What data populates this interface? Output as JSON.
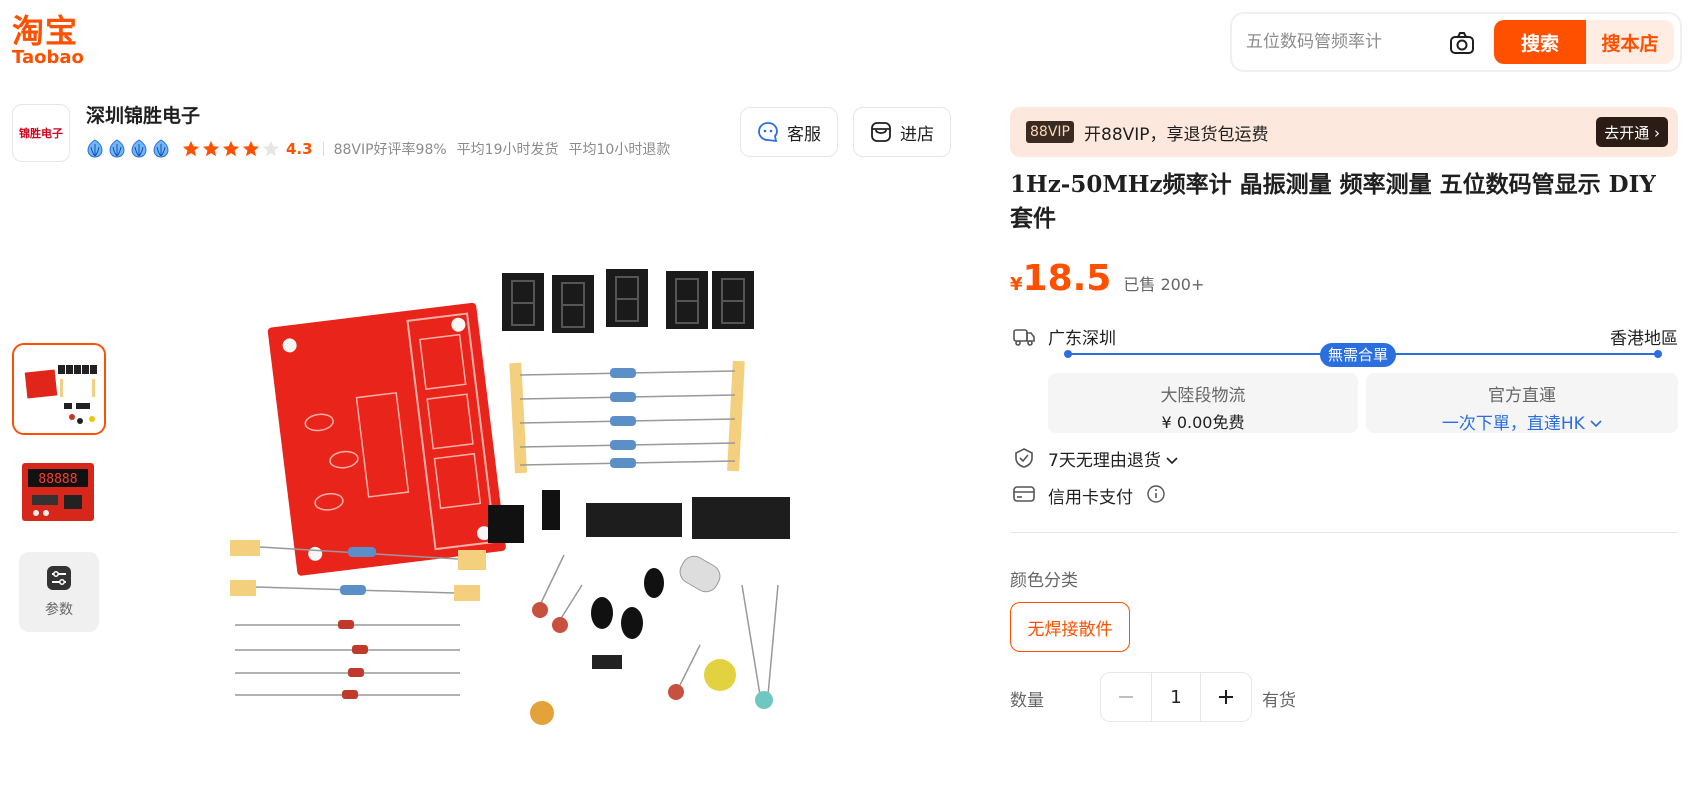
{
  "header": {
    "logo_cn": "淘宝",
    "logo_en": "Taobao",
    "search_placeholder": "五位数码管频率计",
    "search_button": "搜索",
    "store_search_button": "搜本店",
    "accent": "#ff5000"
  },
  "shop": {
    "logo_text": "锦胜电子",
    "name": "深圳锦胜电子",
    "crown_count": 4,
    "rating": "4.3",
    "star_rating": 4.3,
    "stats": [
      "88VIP好评率98%",
      "平均19小时发货",
      "平均10小时退款"
    ],
    "service_button": "客服",
    "enter_button": "进店"
  },
  "gallery": {
    "params_label": "参数"
  },
  "vip": {
    "badge": "88VIP",
    "text": "开88VIP，享退货包运费",
    "cta": "去开通"
  },
  "product": {
    "title": "1Hz-50MHz频率计 晶振测量 频率测量 五位数码管显示 DIY套件",
    "currency": "¥",
    "price": "18.5",
    "sold": "已售 200+"
  },
  "shipping": {
    "origin": "广东深圳",
    "destination": "香港地區",
    "route_tag": "無需合單",
    "card1_title": "大陸段物流",
    "card1_value": "¥ 0.00免费",
    "card2_title": "官方直運",
    "card2_value": "一次下單，直達HK",
    "route_color": "#2a6ee0"
  },
  "services": {
    "return_policy": "7天无理由退货",
    "payment": "信用卡支付"
  },
  "sku": {
    "color_label": "颜色分类",
    "option": "无焊接散件",
    "qty_label": "数量",
    "qty_value": "1",
    "stock": "有货"
  }
}
